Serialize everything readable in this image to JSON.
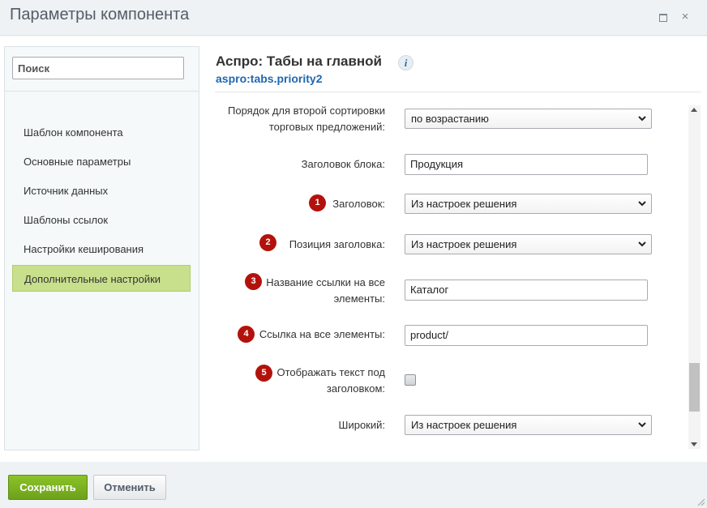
{
  "window": {
    "title": "Параметры компонента",
    "controls": {
      "maximize": "maximize-icon",
      "close": "×"
    }
  },
  "sidebar": {
    "search_placeholder": "Поиск",
    "items": [
      {
        "label": "Шаблон компонента"
      },
      {
        "label": "Основные параметры"
      },
      {
        "label": "Источник данных"
      },
      {
        "label": "Шаблоны ссылок"
      },
      {
        "label": "Настройки кеширования"
      },
      {
        "label": "Дополнительные настройки",
        "active": true
      }
    ]
  },
  "header": {
    "name": "Аспро: Табы на главной",
    "code": "aspro:tabs.priority2",
    "info_icon": "i"
  },
  "form": {
    "rows": [
      {
        "label_line1": "Порядок для второй сортировки",
        "label_line2": "торговых предложений:",
        "type": "select",
        "value": "по возрастанию"
      },
      {
        "label": "Заголовок блока:",
        "type": "input",
        "value": "Продукция"
      },
      {
        "badge": "1",
        "label": "Заголовок:",
        "type": "select",
        "value": "Из настроек решения"
      },
      {
        "badge": "2",
        "label": "Позиция заголовка:",
        "type": "select",
        "value": "Из настроек решения"
      },
      {
        "badge": "3",
        "label_line1": "Название ссылки на все",
        "label_line2": "элементы:",
        "type": "input",
        "value": "Каталог"
      },
      {
        "badge": "4",
        "label": "Ссылка на все элементы:",
        "type": "input",
        "value": "product/"
      },
      {
        "badge": "5",
        "label_line1": "Отображать текст под",
        "label_line2": "заголовком:",
        "type": "checkbox",
        "checked": false
      },
      {
        "label": "Широкий:",
        "type": "select",
        "value": "Из настроек решения"
      }
    ]
  },
  "footer": {
    "save_label": "Сохранить",
    "cancel_label": "Отменить"
  },
  "colors": {
    "accent_green": "#6da11b",
    "active_nav": "#c8e08c",
    "badge_red": "#b3120c",
    "link_blue": "#2067b0"
  }
}
